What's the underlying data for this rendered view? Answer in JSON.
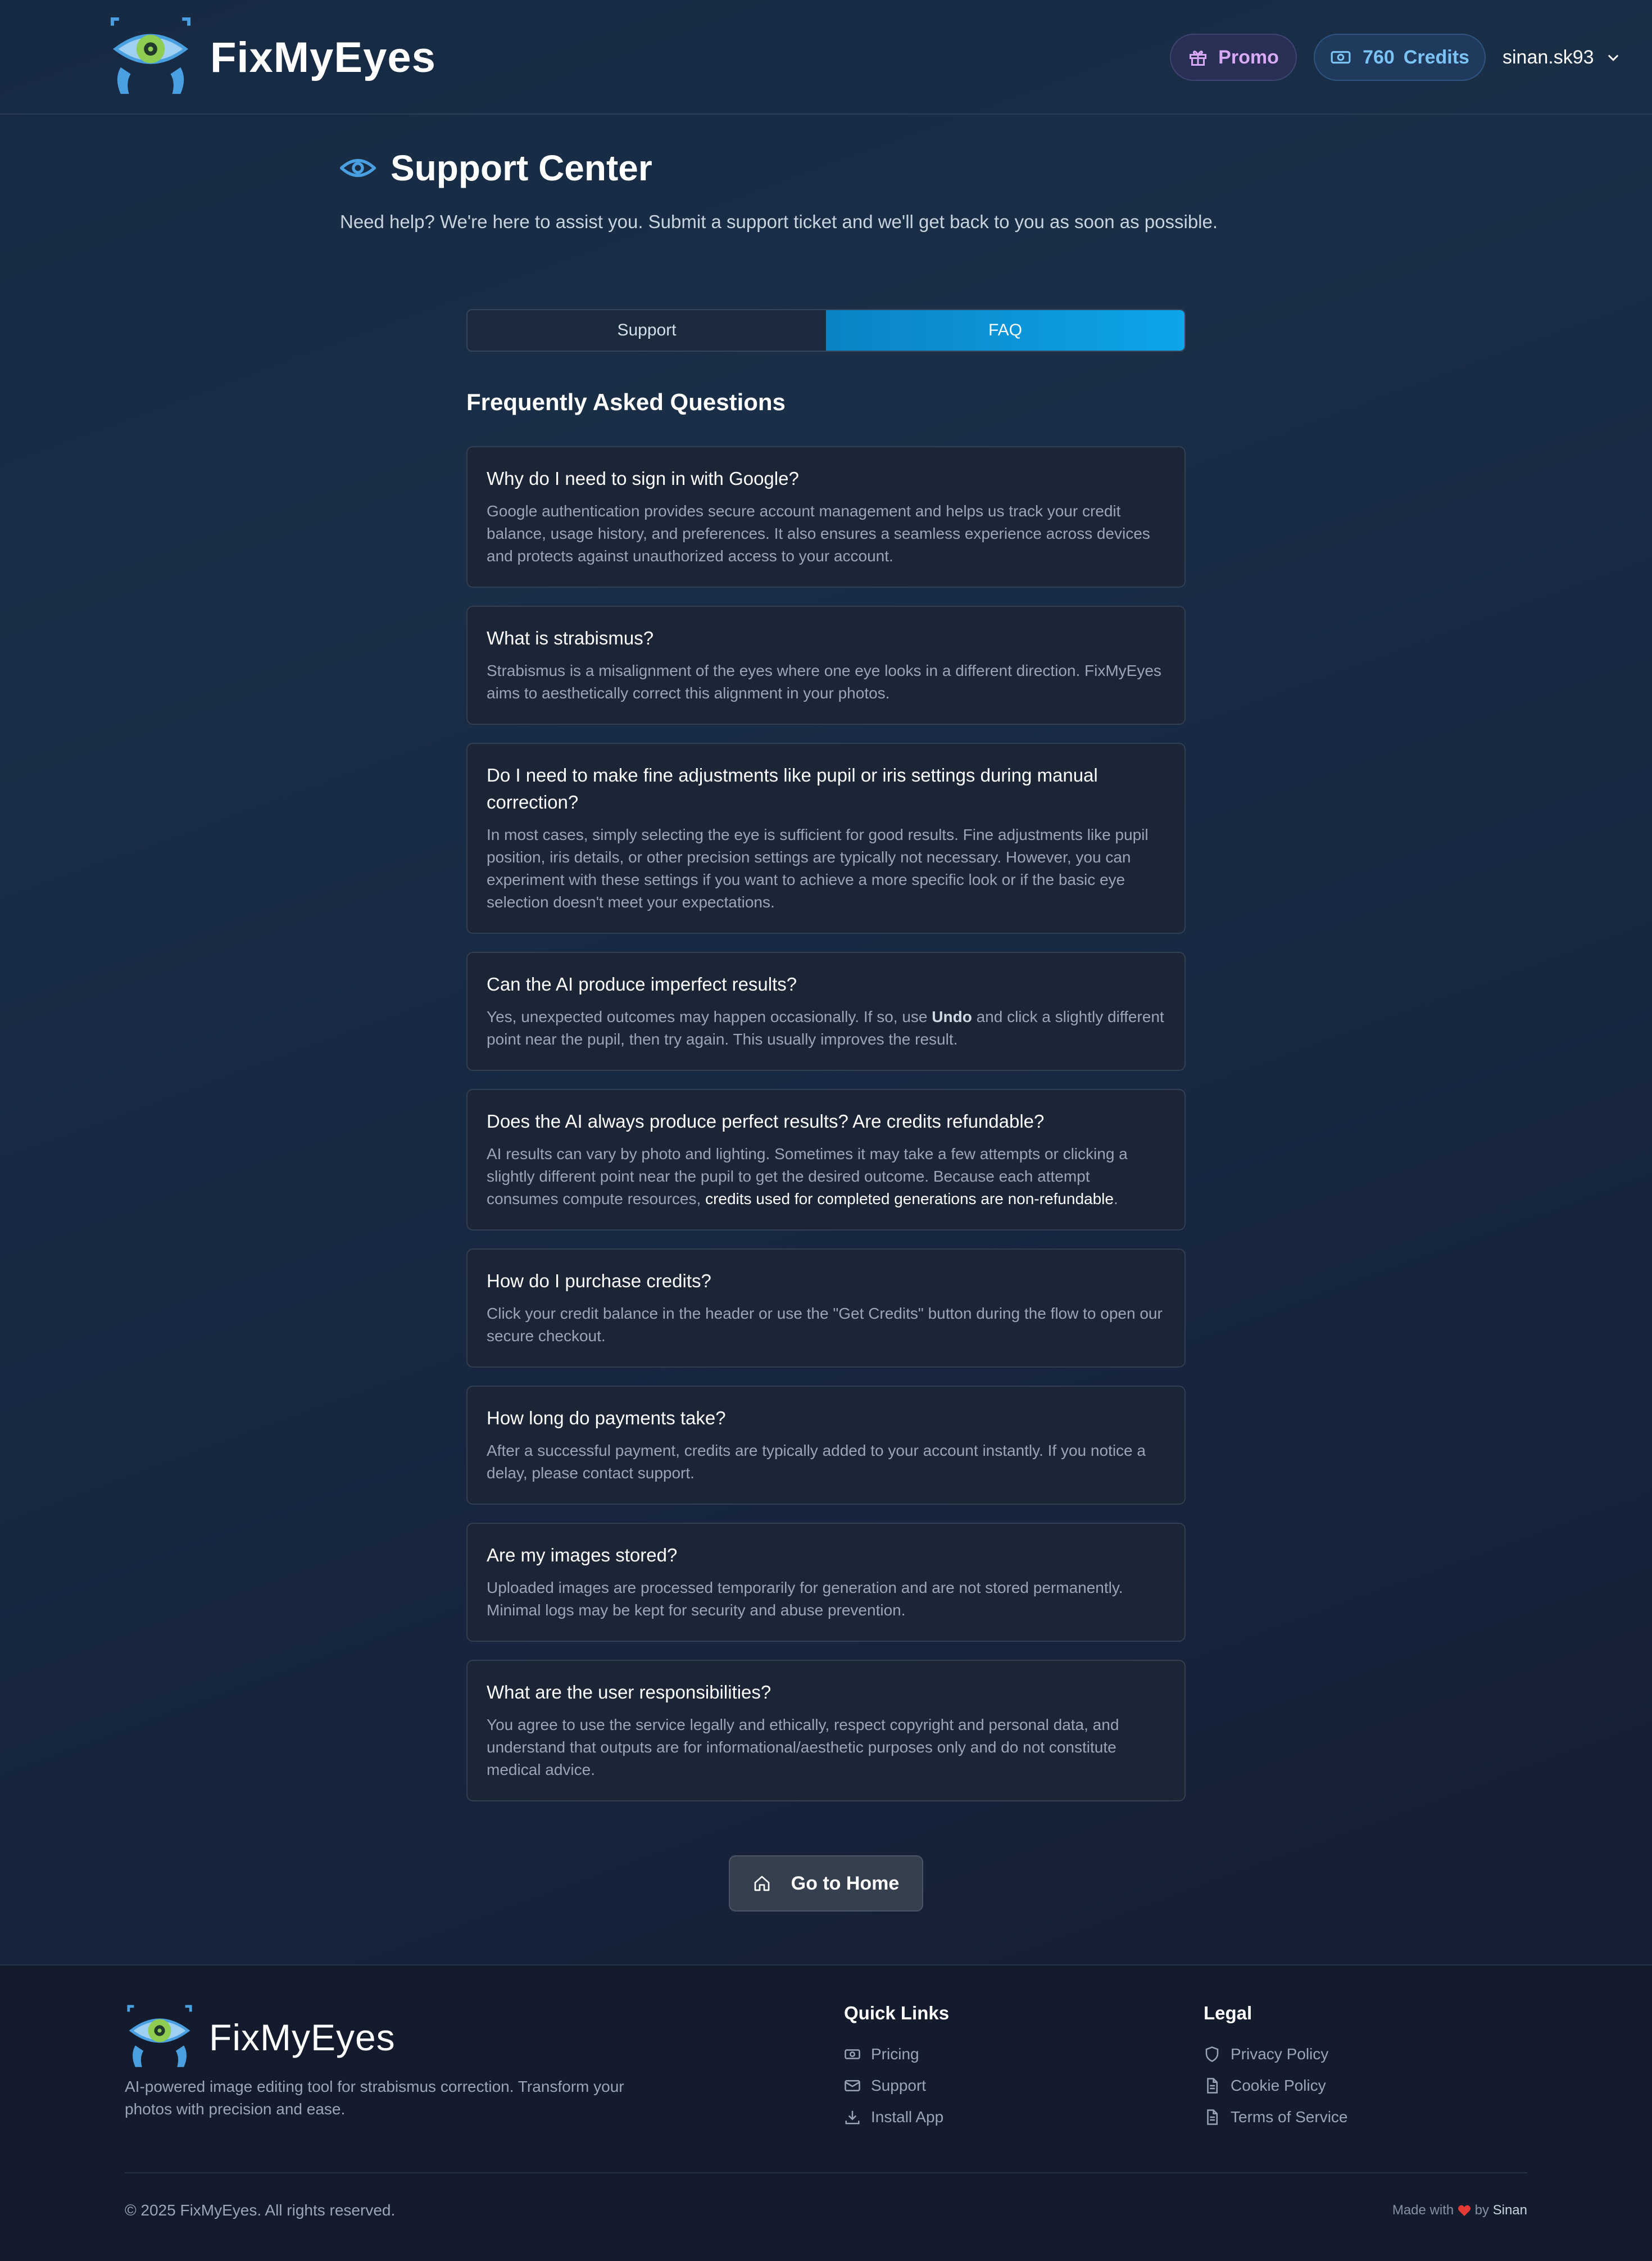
{
  "header": {
    "brand_name": "FixMyEyes",
    "promo_label": "Promo",
    "credits_value": "760",
    "credits_label": "Credits",
    "username": "sinan.sk93"
  },
  "page": {
    "title": "Support Center",
    "subtitle": "Need help? We're here to assist you. Submit a support ticket and we'll get back to you as soon as possible."
  },
  "tabs": [
    {
      "label": "Support",
      "active": false
    },
    {
      "label": "FAQ",
      "active": true
    }
  ],
  "faq": {
    "title": "Frequently Asked Questions",
    "items": [
      {
        "q": "Why do I need to sign in with Google?",
        "a": "Google authentication provides secure account management and helps us track your credit balance, usage history, and preferences. It also ensures a seamless experience across devices and protects against unauthorized access to your account."
      },
      {
        "q": "What is strabismus?",
        "a": "Strabismus is a misalignment of the eyes where one eye looks in a different direction. FixMyEyes aims to aesthetically correct this alignment in your photos."
      },
      {
        "q": "Do I need to make fine adjustments like pupil or iris settings during manual correction?",
        "a": "In most cases, simply selecting the eye is sufficient for good results. Fine adjustments like pupil position, iris details, or other precision settings are typically not necessary. However, you can experiment with these settings if you want to achieve a more specific look or if the basic eye selection doesn't meet your expectations."
      },
      {
        "q": "Can the AI produce imperfect results?",
        "a_before": "Yes, unexpected outcomes may happen occasionally. If so, use ",
        "a_bold": "Undo",
        "a_after": " and click a slightly different point near the pupil, then try again. This usually improves the result."
      },
      {
        "q": "Does the AI always produce perfect results? Are credits refundable?",
        "a_before": "AI results can vary by photo and lighting. Sometimes it may take a few attempts or clicking a slightly different point near the pupil to get the desired outcome. Because each attempt consumes compute resources, ",
        "a_highlight": "credits used for completed generations are non-refundable",
        "a_after": "."
      },
      {
        "q": "How do I purchase credits?",
        "a": "Click your credit balance in the header or use the \"Get Credits\" button during the flow to open our secure checkout."
      },
      {
        "q": "How long do payments take?",
        "a": "After a successful payment, credits are typically added to your account instantly. If you notice a delay, please contact support."
      },
      {
        "q": "Are my images stored?",
        "a": "Uploaded images are processed temporarily for generation and are not stored permanently. Minimal logs may be kept for security and abuse prevention."
      },
      {
        "q": "What are the user responsibilities?",
        "a": "You agree to use the service legally and ethically, respect copyright and personal data, and understand that outputs are for informational/aesthetic purposes only and do not constitute medical advice."
      }
    ]
  },
  "home_button": {
    "label": "Go to Home",
    "icon": "home-icon"
  },
  "footer": {
    "brand_name": "FixMyEyes",
    "description": "AI-powered image editing tool for strabismus correction. Transform your photos with precision and ease.",
    "quick_links": {
      "title": "Quick Links",
      "items": [
        {
          "label": "Pricing",
          "icon": "money-icon"
        },
        {
          "label": "Support",
          "icon": "mail-icon"
        },
        {
          "label": "Install App",
          "icon": "download-icon"
        }
      ]
    },
    "legal": {
      "title": "Legal",
      "items": [
        {
          "label": "Privacy Policy",
          "icon": "shield-icon"
        },
        {
          "label": "Cookie Policy",
          "icon": "document-icon"
        },
        {
          "label": "Terms of Service",
          "icon": "document-icon"
        }
      ]
    },
    "copyright": "© 2025 FixMyEyes. All rights reserved.",
    "made_with_prefix": "Made with",
    "made_with_by": "by",
    "made_with_author": "Sinan"
  },
  "colors": {
    "accent": "#0ea5e9",
    "promo_text": "#d8a9f5",
    "credits_text": "#7cc3f5",
    "logo_blue": "#4a9fe0",
    "logo_green": "#8fcc52"
  }
}
